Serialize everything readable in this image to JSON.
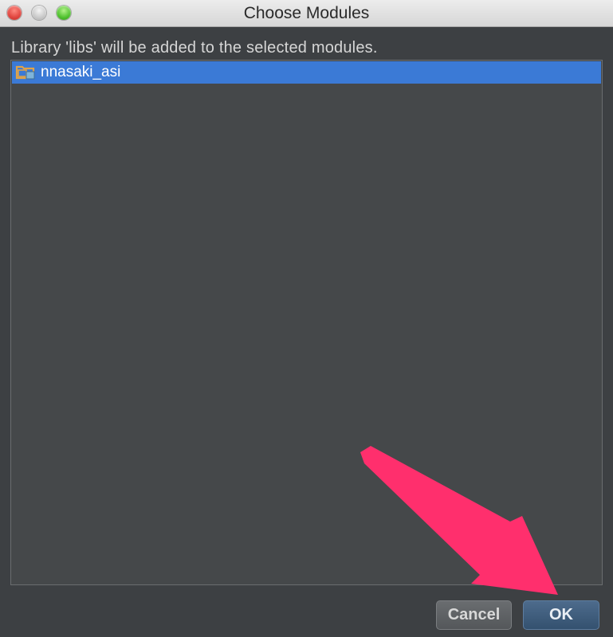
{
  "window": {
    "title": "Choose Modules"
  },
  "dialog": {
    "message": "Library 'libs' will be added to the selected modules.",
    "modules": [
      {
        "label": "nnasaki_asi",
        "icon": "module-folder-icon",
        "selected": true
      }
    ]
  },
  "buttons": {
    "cancel_label": "Cancel",
    "ok_label": "OK"
  },
  "colors": {
    "selection": "#3b7ad6",
    "annotation_arrow": "#ff2f6d"
  },
  "annotation": {
    "icon": "pointer-arrow"
  }
}
